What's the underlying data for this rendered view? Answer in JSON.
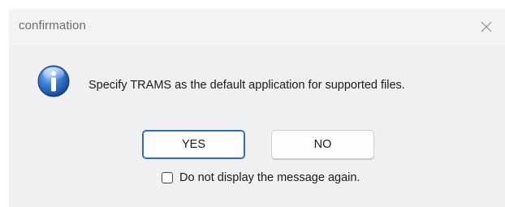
{
  "window": {
    "title": "confirmation",
    "close_icon": "close-icon"
  },
  "dialog": {
    "icon": "info-icon",
    "message": "Specify TRAMS as the default application for supported files."
  },
  "buttons": {
    "yes_label": "YES",
    "no_label": "NO",
    "default": "yes"
  },
  "checkbox": {
    "label": "Do not display the message again.",
    "checked": false
  },
  "colors": {
    "dialog_bg": "#f0f0f0",
    "default_button_border": "#2a6cc0",
    "icon_blue": "#1f5fbf"
  }
}
